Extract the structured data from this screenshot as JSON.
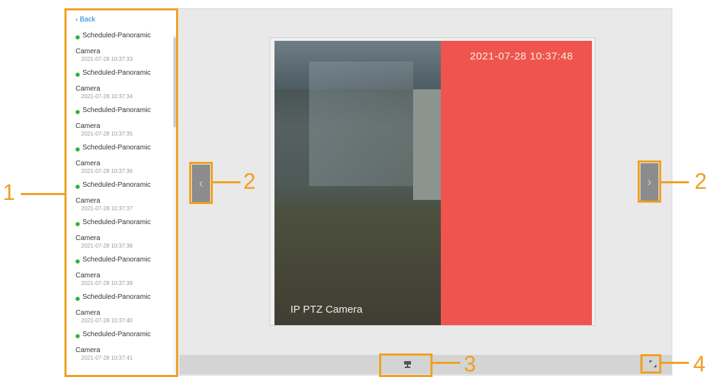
{
  "sidebar": {
    "back_label": "Back",
    "items": [
      {
        "line1": "Scheduled-Panoramic",
        "line2": "Camera",
        "time": "2021-07-28 10:37:33"
      },
      {
        "line1": "Scheduled-Panoramic",
        "line2": "Camera",
        "time": "2021-07-28 10:37:34"
      },
      {
        "line1": "Scheduled-Panoramic",
        "line2": "Camera",
        "time": "2021-07-28 10:37:35"
      },
      {
        "line1": "Scheduled-Panoramic",
        "line2": "Camera",
        "time": "2021-07-28 10:37:36"
      },
      {
        "line1": "Scheduled-Panoramic",
        "line2": "Camera",
        "time": "2021-07-28 10:37:37"
      },
      {
        "line1": "Scheduled-Panoramic",
        "line2": "Camera",
        "time": "2021-07-28 10:37:38"
      },
      {
        "line1": "Scheduled-Panoramic",
        "line2": "Camera",
        "time": "2021-07-28 10:37:39"
      },
      {
        "line1": "Scheduled-Panoramic",
        "line2": "Camera",
        "time": "2021-07-28 10:37:40"
      },
      {
        "line1": "Scheduled-Panoramic",
        "line2": "Camera",
        "time": "2021-07-28 10:37:41"
      }
    ]
  },
  "viewer": {
    "timestamp": "2021-07-28 10:37:48",
    "camera_label": "IP PTZ Camera",
    "prev_icon": "chevron-left-icon",
    "next_icon": "chevron-right-icon",
    "prev_glyph": "‹",
    "next_glyph": "›"
  },
  "toolbar": {
    "ptz_icon": "ptz-camera-icon",
    "fullscreen_icon": "fullscreen-icon"
  },
  "callouts": {
    "list": "1",
    "prev": "2",
    "next": "2",
    "ptz": "3",
    "fullscreen": "4"
  },
  "colors": {
    "accent": "#f0a020",
    "link": "#1a7fe0",
    "status_dot": "#2eb33a",
    "red_overlay": "#f0544e"
  }
}
